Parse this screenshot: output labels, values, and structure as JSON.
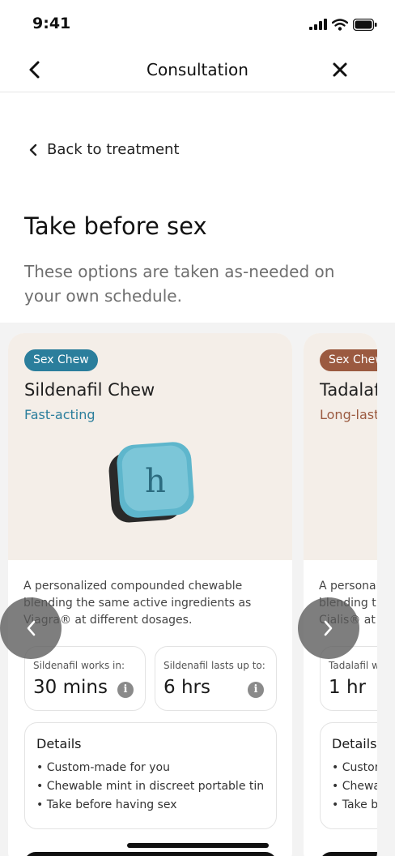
{
  "status_bar": {
    "time": "9:41",
    "icons": [
      "signal-icon",
      "wifi-icon",
      "battery-icon"
    ]
  },
  "nav": {
    "title": "Consultation",
    "back_icon": "chevron-left-icon",
    "close_icon": "close-icon"
  },
  "back_link": {
    "label": "Back to treatment"
  },
  "section": {
    "title": "Take before sex",
    "subtitle": "These options are taken as-needed on your own schedule."
  },
  "cards": [
    {
      "badge": "Sex Chew",
      "name": "Sildenafil Chew",
      "tag": "Fast-acting",
      "image_letter": "h",
      "description": "A personalized compounded chewable blending the same active ingredients as Viagra® at different dosages.",
      "stats": [
        {
          "label": "Sildenafil works in:",
          "value": "30 mins"
        },
        {
          "label": "Sildenafil lasts up to:",
          "value": "6 hrs"
        }
      ],
      "details_title": "Details",
      "details": [
        "• Custom-made for you",
        "• Chewable mint in discreet portable tin",
        "• Take before having sex"
      ]
    },
    {
      "badge": "Sex Chew",
      "name": "Tadalafil Chew",
      "tag": "Long-lasting",
      "description": "A personalized compounded chewable blending the same active ingredients as Cialis® at different dosages.",
      "stats": [
        {
          "label": "Tadalafil works in:",
          "value": "1 hr"
        }
      ],
      "details_title": "Details",
      "details": [
        "• Custom-made for you",
        "• Chewable mint in discreet portable tin",
        "• Take before having sex"
      ]
    }
  ],
  "info_glyph": "i",
  "carousel_controls": {
    "prev_icon": "chevron-left-icon",
    "next_icon": "chevron-right-icon"
  },
  "colors": {
    "accent_blue": "#2b7e9c",
    "accent_brown": "#9b5a40",
    "card_top_bg": "#f4eee8"
  }
}
